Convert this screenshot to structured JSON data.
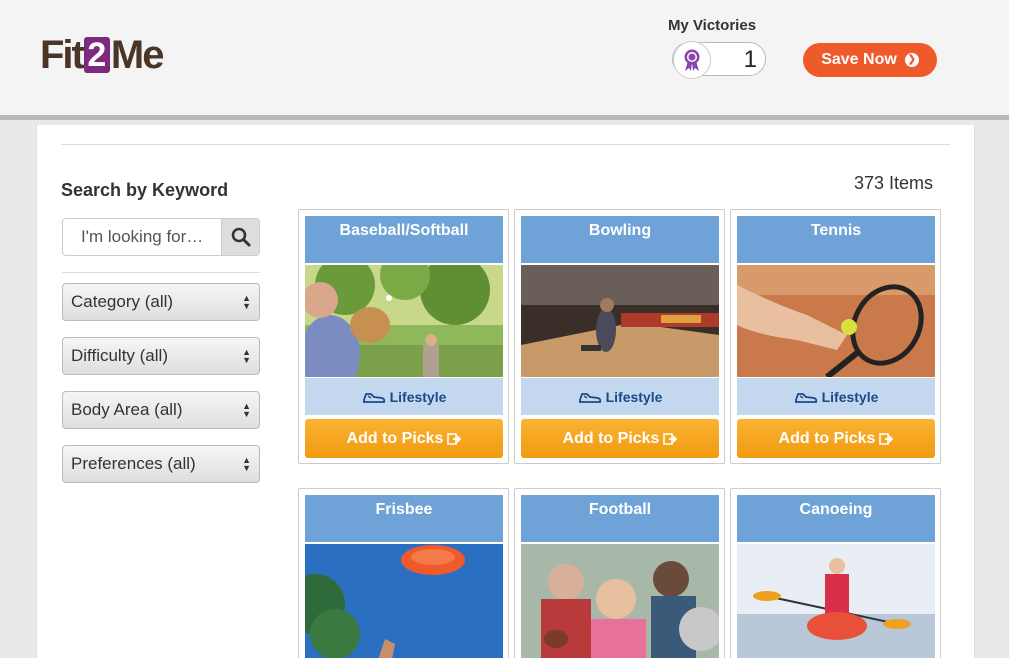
{
  "header": {
    "logo_left": "Fit",
    "logo_num": "2",
    "logo_right": "Me",
    "victories_label": "My Victories",
    "victories_count": "1",
    "save_label": "Save Now"
  },
  "sidebar": {
    "search_title": "Search by Keyword",
    "search_placeholder": "I'm looking for…",
    "filters": [
      "Category (all)",
      "Difficulty (all)",
      "Body Area (all)",
      "Preferences (all)"
    ]
  },
  "results": {
    "count_label": "373 Items",
    "cards": [
      {
        "title": "Baseball/Softball",
        "tag": "Lifestyle",
        "button": "Add to Picks"
      },
      {
        "title": "Bowling",
        "tag": "Lifestyle",
        "button": "Add to Picks"
      },
      {
        "title": "Tennis",
        "tag": "Lifestyle",
        "button": "Add to Picks"
      },
      {
        "title": "Frisbee"
      },
      {
        "title": "Football"
      },
      {
        "title": "Canoeing"
      }
    ]
  },
  "colors": {
    "brand_purple": "#7d2a7e",
    "save_orange": "#ef5a2a",
    "card_blue": "#6fa3d8",
    "tag_blue": "#c3d8ee",
    "add_button_orange": "#f5a11e"
  },
  "icons": {
    "search": "magnifier-icon",
    "victory": "ribbon-award-icon",
    "tag": "sneaker-icon",
    "add": "arrow-export-icon"
  }
}
